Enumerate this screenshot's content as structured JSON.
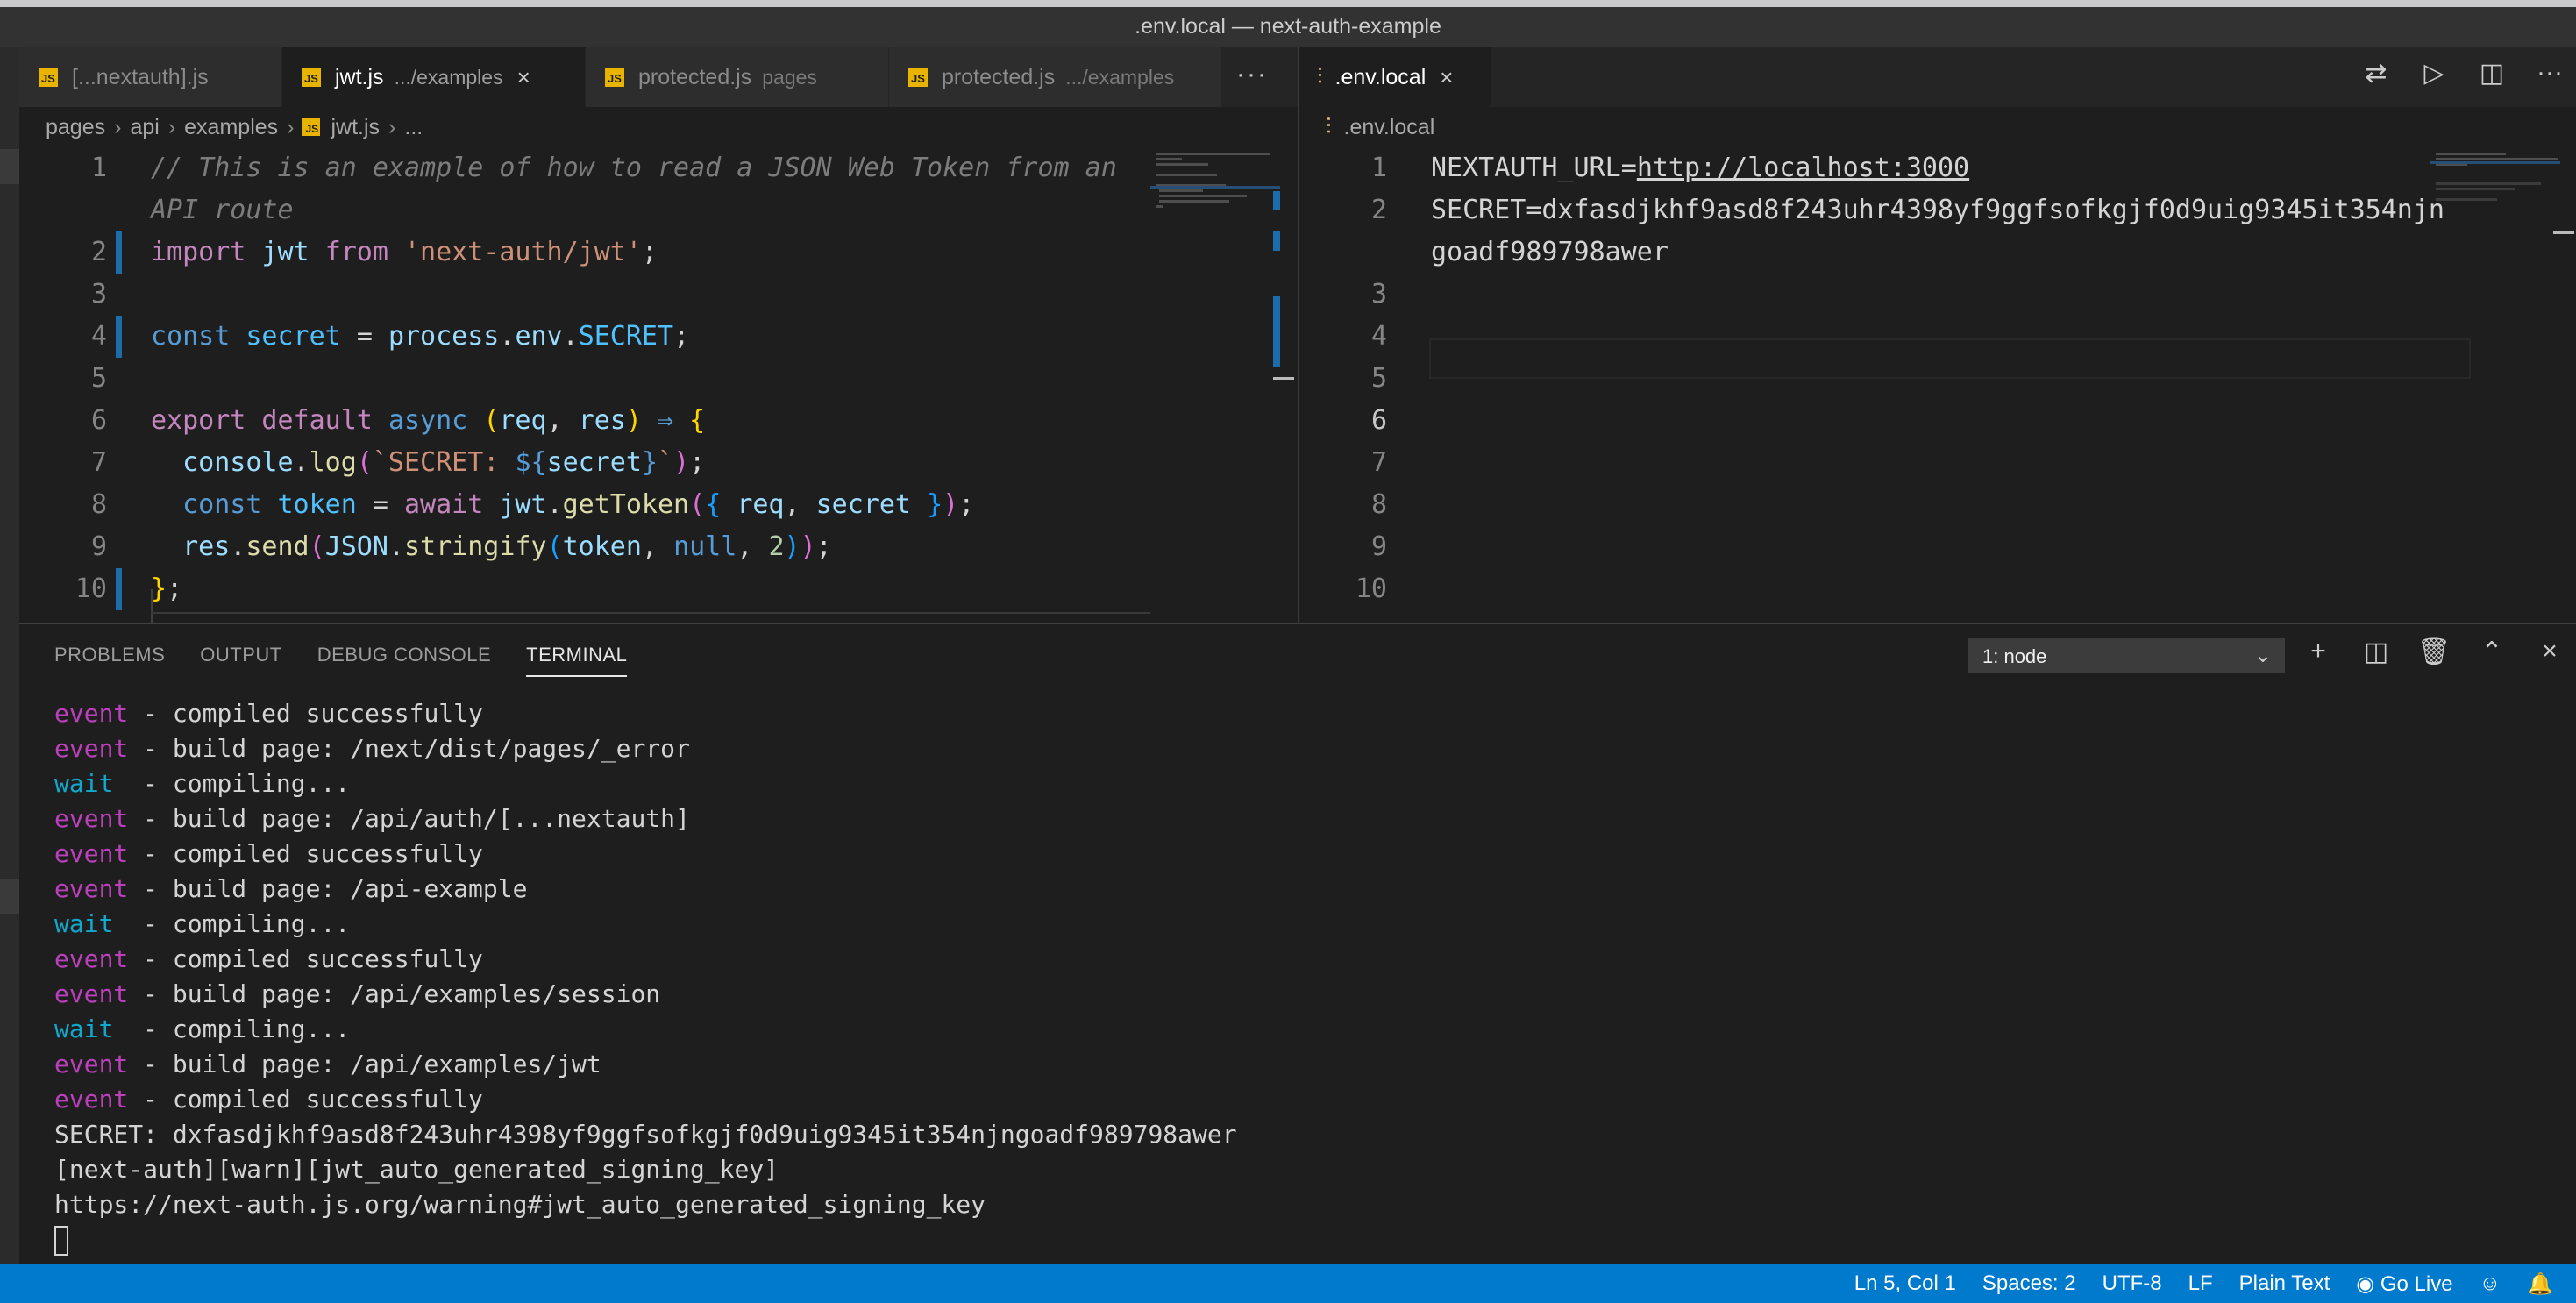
{
  "window": {
    "title": ".env.local — next-auth-example"
  },
  "left_tabs": [
    {
      "label": "[...nextauth].js",
      "desc": ""
    },
    {
      "label": "jwt.js",
      "desc": ".../examples",
      "active": true
    },
    {
      "label": "protected.js",
      "desc": "pages"
    },
    {
      "label": "protected.js",
      "desc": ".../examples"
    }
  ],
  "right_tabs": [
    {
      "label": ".env.local",
      "active": true
    }
  ],
  "icons": {
    "js": "JS",
    "close": "×",
    "more": "···",
    "chevron": "›",
    "env": "⫶",
    "compare": "⇄",
    "run": "▷",
    "split": "◫",
    "plus": "+",
    "trash": "🗑",
    "chevron_up": "⌃",
    "close_panel": "×",
    "chevron_down": "⌄"
  },
  "breadcrumb_left": {
    "items": [
      "pages",
      "api",
      "examples",
      "jwt.js",
      "..."
    ]
  },
  "breadcrumb_right": {
    "file": ".env.local"
  },
  "left_editor": {
    "line_numbers": [
      "1",
      "",
      "2",
      "3",
      "4",
      "5",
      "6",
      "7",
      "8",
      "9",
      "10"
    ],
    "lines": [
      [
        [
          "cmt",
          "// This is an example of how to read a JSON Web Token from an"
        ]
      ],
      [
        [
          "cmt",
          "API route"
        ]
      ],
      [
        [
          "kw",
          "import "
        ],
        [
          "id",
          "jwt "
        ],
        [
          "kw",
          "from "
        ],
        [
          "str",
          "'next-auth/jwt'"
        ],
        [
          "pn",
          ";"
        ]
      ],
      [],
      [
        [
          "lit",
          "const "
        ],
        [
          "const",
          "secret "
        ],
        [
          "pn",
          "= "
        ],
        [
          "id",
          "process"
        ],
        [
          "pn",
          "."
        ],
        [
          "id",
          "env"
        ],
        [
          "pn",
          "."
        ],
        [
          "const",
          "SECRET"
        ],
        [
          "pn",
          ";"
        ]
      ],
      [],
      [
        [
          "kw",
          "export default "
        ],
        [
          "lit",
          "async "
        ],
        [
          "br1",
          "("
        ],
        [
          "id",
          "req"
        ],
        [
          "pn",
          ", "
        ],
        [
          "id",
          "res"
        ],
        [
          "br1",
          ")"
        ],
        [
          "pn",
          " "
        ],
        [
          "lit",
          "⇒"
        ],
        [
          "pn",
          " "
        ],
        [
          "br1",
          "{"
        ]
      ],
      [
        [
          "pn",
          "  "
        ],
        [
          "id",
          "console"
        ],
        [
          "pn",
          "."
        ],
        [
          "fn",
          "log"
        ],
        [
          "br2",
          "("
        ],
        [
          "str",
          "`SECRET: "
        ],
        [
          "lit",
          "${"
        ],
        [
          "id",
          "secret"
        ],
        [
          "lit",
          "}"
        ],
        [
          "str",
          "`"
        ],
        [
          "br2",
          ")"
        ],
        [
          "pn",
          ";"
        ]
      ],
      [
        [
          "pn",
          "  "
        ],
        [
          "lit",
          "const "
        ],
        [
          "const",
          "token "
        ],
        [
          "pn",
          "= "
        ],
        [
          "kw",
          "await "
        ],
        [
          "id",
          "jwt"
        ],
        [
          "pn",
          "."
        ],
        [
          "fn",
          "getToken"
        ],
        [
          "br2",
          "("
        ],
        [
          "br3",
          "{ "
        ],
        [
          "id",
          "req"
        ],
        [
          "pn",
          ", "
        ],
        [
          "id",
          "secret "
        ],
        [
          "br3",
          "}"
        ],
        [
          "br2",
          ")"
        ],
        [
          "pn",
          ";"
        ]
      ],
      [
        [
          "pn",
          "  "
        ],
        [
          "id",
          "res"
        ],
        [
          "pn",
          "."
        ],
        [
          "fn",
          "send"
        ],
        [
          "br2",
          "("
        ],
        [
          "id",
          "JSON"
        ],
        [
          "pn",
          "."
        ],
        [
          "fn",
          "stringify"
        ],
        [
          "br3",
          "("
        ],
        [
          "id",
          "token"
        ],
        [
          "pn",
          ", "
        ],
        [
          "lit",
          "null"
        ],
        [
          "pn",
          ", "
        ],
        [
          "num",
          "2"
        ],
        [
          "br3",
          ")"
        ],
        [
          "br2",
          ")"
        ],
        [
          "pn",
          ";"
        ]
      ],
      [
        [
          "br1",
          "}"
        ],
        [
          "pn",
          ";"
        ]
      ]
    ]
  },
  "right_editor": {
    "line_numbers": [
      "1",
      "2",
      "",
      "3",
      "4",
      "5",
      "6",
      "7",
      "8",
      "9",
      "10"
    ],
    "lines": [
      [
        [
          "plain",
          "NEXTAUTH_URL="
        ],
        [
          "url",
          "http://localhost:3000"
        ]
      ],
      [
        [
          "plain",
          "SECRET=dxfasdjkhf9asd8f243uhr4398yf9ggfsofkgjf0d9uig9345it354njn"
        ]
      ],
      [
        [
          "plain",
          "goadf989798awer"
        ]
      ],
      [],
      [],
      [],
      [],
      [],
      [],
      [],
      []
    ]
  },
  "panel": {
    "tabs": [
      "PROBLEMS",
      "OUTPUT",
      "DEBUG CONSOLE",
      "TERMINAL"
    ],
    "active_tab": "TERMINAL",
    "terminal_select": "1: node",
    "terminal_lines": [
      [
        "event",
        " - compiled successfully"
      ],
      [
        "event",
        " - build page: /next/dist/pages/_error"
      ],
      [
        "wait",
        "  - compiling..."
      ],
      [
        "event",
        " - build page: /api/auth/[...nextauth]"
      ],
      [
        "event",
        " - compiled successfully"
      ],
      [
        "event",
        " - build page: /api-example"
      ],
      [
        "wait",
        "  - compiling..."
      ],
      [
        "event",
        " - compiled successfully"
      ],
      [
        "event",
        " - build page: /api/examples/session"
      ],
      [
        "wait",
        "  - compiling..."
      ],
      [
        "event",
        " - build page: /api/examples/jwt"
      ],
      [
        "event",
        " - compiled successfully"
      ],
      [
        "",
        "SECRET: dxfasdjkhf9asd8f243uhr4398yf9ggfsofkgjf0d9uig9345it354njngoadf989798awer"
      ],
      [
        "",
        "[next-auth][warn][jwt_auto_generated_signing_key]"
      ],
      [
        "",
        "https://next-auth.js.org/warning#jwt_auto_generated_signing_key"
      ]
    ]
  },
  "statusbar": {
    "position": "Ln 5, Col 1",
    "spaces": "Spaces: 2",
    "encoding": "UTF-8",
    "eol": "LF",
    "language": "Plain Text",
    "go_live": "Go Live",
    "go_live_icon": "◉",
    "feedback_icon": "☺",
    "bell_icon": "🔔"
  },
  "colors": {
    "accent": "#007acc",
    "event": "#bc3fbc",
    "wait": "#11a8cd",
    "js_badge": "#e8b400"
  }
}
